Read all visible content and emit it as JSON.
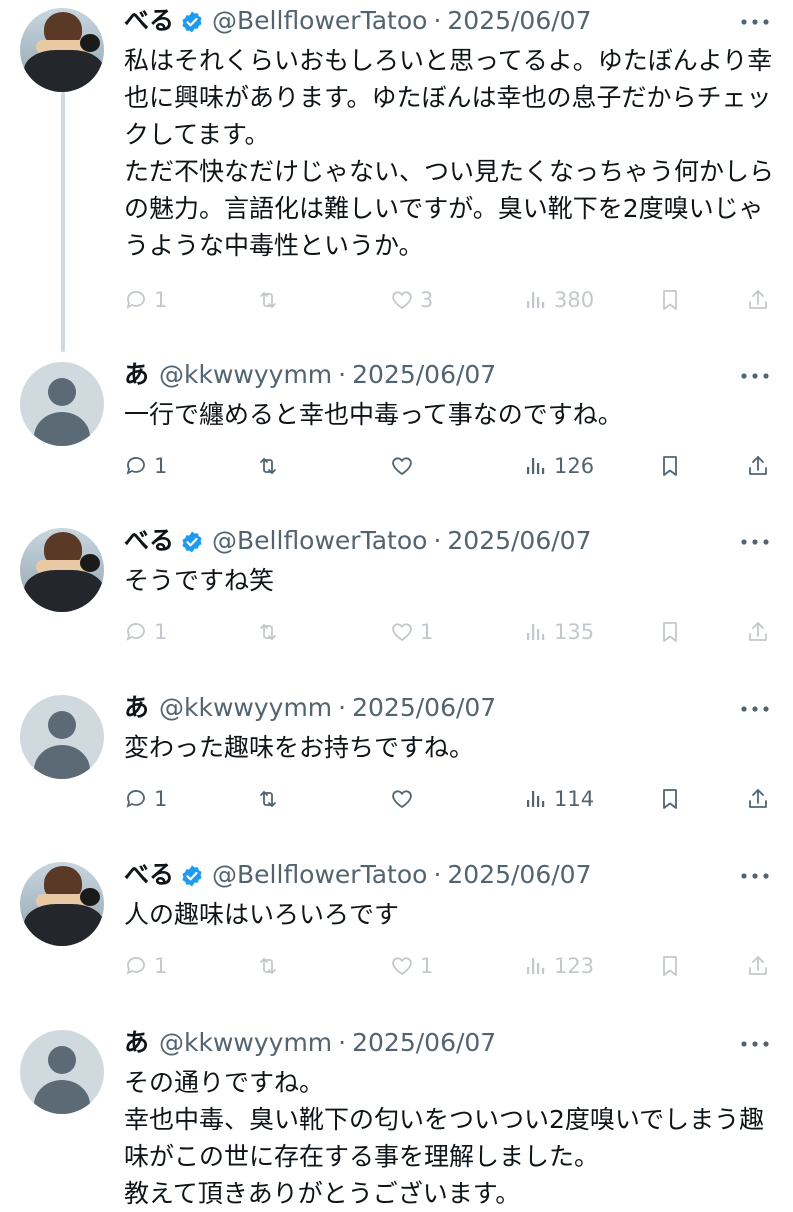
{
  "posts": [
    {
      "author": "べる",
      "verified": true,
      "handle": "@BellflowerTatoo",
      "sep": "·",
      "date": "2025/06/07",
      "text": "私はそれくらいおもしろいと思ってるよ。ゆたぼんより幸也に興味があります。ゆたぼんは幸也の息子だからチェックしてます。\nただ不快なだけじゃない、つい見たくなっちゃう何かしらの魅力。言語化は難しいですが。臭い靴下を2度嗅いじゃうような中毒性というか。",
      "replies": "1",
      "retweets": "",
      "likes": "3",
      "views": "380",
      "faded": true
    },
    {
      "author": "あ",
      "verified": false,
      "handle": "@kkwwyymm",
      "sep": "·",
      "date": "2025/06/07",
      "text": "一行で纏めると幸也中毒って事なのですね。",
      "replies": "1",
      "retweets": "",
      "likes": "",
      "views": "126",
      "faded": false
    },
    {
      "author": "べる",
      "verified": true,
      "handle": "@BellflowerTatoo",
      "sep": "·",
      "date": "2025/06/07",
      "text": "そうですね笑",
      "replies": "1",
      "retweets": "",
      "likes": "1",
      "views": "135",
      "faded": true
    },
    {
      "author": "あ",
      "verified": false,
      "handle": "@kkwwyymm",
      "sep": "·",
      "date": "2025/06/07",
      "text": "変わった趣味をお持ちですね。",
      "replies": "1",
      "retweets": "",
      "likes": "",
      "views": "114",
      "faded": false
    },
    {
      "author": "べる",
      "verified": true,
      "handle": "@BellflowerTatoo",
      "sep": "·",
      "date": "2025/06/07",
      "text": "人の趣味はいろいろです",
      "replies": "1",
      "retweets": "",
      "likes": "1",
      "views": "123",
      "faded": true
    },
    {
      "author": "あ",
      "verified": false,
      "handle": "@kkwwyymm",
      "sep": "·",
      "date": "2025/06/07",
      "text": "その通りですね。\n幸也中毒、臭い靴下の匂いをついつい2度嗅いでしまう趣味がこの世に存在する事を理解しました。\n教えて頂きありがとうございます。",
      "replies": "",
      "retweets": "",
      "likes": "",
      "views": "",
      "faded": false
    }
  ],
  "icons": {
    "reply": "reply-icon",
    "retweet": "retweet-icon",
    "like": "heart-icon",
    "views": "views-icon",
    "bookmark": "bookmark-icon",
    "share": "share-icon",
    "more": "more-icon",
    "verified": "verified-badge-icon"
  },
  "colors": {
    "text": "#0f1419",
    "secondary": "#536471",
    "verified": "#1d9bf0",
    "thread_line": "#cfd9de"
  }
}
